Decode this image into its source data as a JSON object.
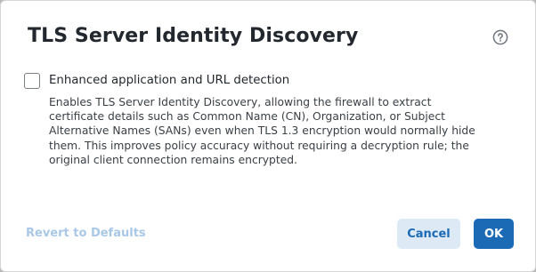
{
  "dialog": {
    "title": "TLS Server Identity Discovery",
    "help_icon": "help-circle-icon",
    "option": {
      "checked": false,
      "label": "Enhanced application and URL detection",
      "description_lines": [
        "Enables TLS Server Identity Discovery, allowing the firewall to extract",
        "certificate details such as Common Name (CN), Organization, or Subject",
        "Alternative Names (SANs) even when TLS 1.3 encryption would normally hide",
        "them. This improves policy accuracy without requiring a decryption rule; the",
        "original client connection remains encrypted."
      ]
    },
    "footer": {
      "revert_label": "Revert to Defaults",
      "cancel_label": "Cancel",
      "ok_label": "OK"
    }
  },
  "colors": {
    "primary": "#1b6ab6",
    "secondary_bg": "#dde9f4",
    "disabled_link": "#a9c8e6",
    "text": "#23282e"
  }
}
